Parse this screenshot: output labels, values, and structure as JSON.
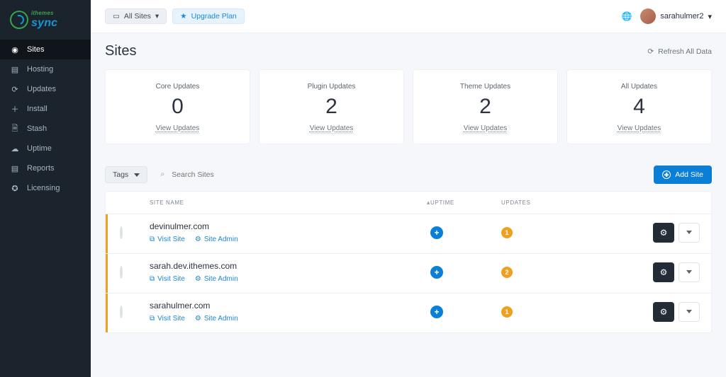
{
  "logo": {
    "sub": "ithemes",
    "main": "sync"
  },
  "nav": {
    "items": [
      {
        "label": "Sites",
        "icon": "sites"
      },
      {
        "label": "Hosting",
        "icon": "hosting"
      },
      {
        "label": "Updates",
        "icon": "updates"
      },
      {
        "label": "Install",
        "icon": "install"
      },
      {
        "label": "Stash",
        "icon": "stash"
      },
      {
        "label": "Uptime",
        "icon": "uptime"
      },
      {
        "label": "Reports",
        "icon": "reports"
      },
      {
        "label": "Licensing",
        "icon": "licensing"
      }
    ]
  },
  "topbar": {
    "site_filter_label": "All Sites",
    "upgrade_label": "Upgrade Plan",
    "username": "sarahulmer2"
  },
  "title": {
    "heading": "Sites",
    "refresh_label": "Refresh All Data"
  },
  "cards": [
    {
      "label": "Core Updates",
      "value": "0",
      "link": "View Updates"
    },
    {
      "label": "Plugin Updates",
      "value": "2",
      "link": "View Updates"
    },
    {
      "label": "Theme Updates",
      "value": "2",
      "link": "View Updates"
    },
    {
      "label": "All Updates",
      "value": "4",
      "link": "View Updates"
    }
  ],
  "toolbar": {
    "tags_label": "Tags",
    "search_placeholder": "Search Sites",
    "add_site_label": "Add Site"
  },
  "table": {
    "columns": {
      "site": "SITE NAME",
      "uptime": "UPTIME",
      "updates": "UPDATES"
    },
    "rows": [
      {
        "name": "devinulmer.com",
        "visit": "Visit Site",
        "admin": "Site Admin",
        "uptime_plus": true,
        "updates": "1"
      },
      {
        "name": "sarah.dev.ithemes.com",
        "visit": "Visit Site",
        "admin": "Site Admin",
        "uptime_plus": true,
        "updates": "2"
      },
      {
        "name": "sarahulmer.com",
        "visit": "Visit Site",
        "admin": "Site Admin",
        "uptime_plus": true,
        "updates": "1"
      }
    ]
  }
}
